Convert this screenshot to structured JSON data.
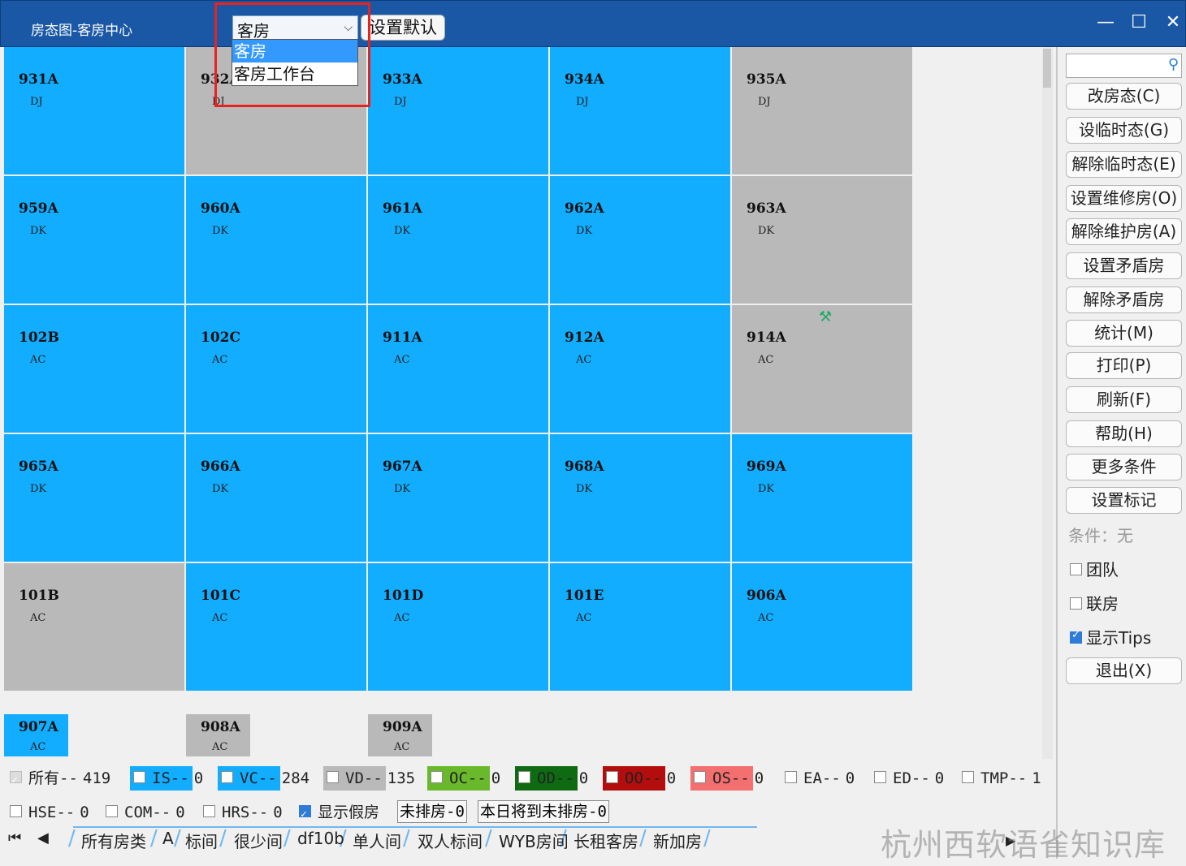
{
  "window": {
    "title": "房态图-客房中心",
    "minimize": "—",
    "maximize": "☐",
    "close": "✕"
  },
  "mode_select": {
    "value": "客房",
    "options": [
      "客房",
      "客房工作台"
    ]
  },
  "set_default_label": "设置默认",
  "rooms": [
    {
      "num": "931A",
      "code": "DJ",
      "status": "blue"
    },
    {
      "num": "932A",
      "code": "DJ",
      "status": "gray"
    },
    {
      "num": "933A",
      "code": "DJ",
      "status": "blue"
    },
    {
      "num": "934A",
      "code": "DJ",
      "status": "blue"
    },
    {
      "num": "935A",
      "code": "DJ",
      "status": "gray"
    },
    {
      "num": "959A",
      "code": "DK",
      "status": "blue"
    },
    {
      "num": "960A",
      "code": "DK",
      "status": "blue"
    },
    {
      "num": "961A",
      "code": "DK",
      "status": "blue"
    },
    {
      "num": "962A",
      "code": "DK",
      "status": "blue"
    },
    {
      "num": "963A",
      "code": "DK",
      "status": "gray"
    },
    {
      "num": "102B",
      "code": "AC",
      "status": "blue"
    },
    {
      "num": "102C",
      "code": "AC",
      "status": "blue"
    },
    {
      "num": "911A",
      "code": "AC",
      "status": "blue"
    },
    {
      "num": "912A",
      "code": "AC",
      "status": "blue"
    },
    {
      "num": "914A",
      "code": "AC",
      "status": "gray"
    },
    {
      "num": "965A",
      "code": "DK",
      "status": "blue"
    },
    {
      "num": "966A",
      "code": "DK",
      "status": "blue"
    },
    {
      "num": "967A",
      "code": "DK",
      "status": "blue"
    },
    {
      "num": "968A",
      "code": "DK",
      "status": "blue"
    },
    {
      "num": "969A",
      "code": "DK",
      "status": "blue"
    },
    {
      "num": "101B",
      "code": "AC",
      "status": "gray"
    },
    {
      "num": "101C",
      "code": "AC",
      "status": "blue"
    },
    {
      "num": "101D",
      "code": "AC",
      "status": "blue"
    },
    {
      "num": "101E",
      "code": "AC",
      "status": "blue"
    },
    {
      "num": "906A",
      "code": "AC",
      "status": "blue"
    }
  ],
  "small_rooms": [
    {
      "num": "907A",
      "code": "AC",
      "status": "blue"
    },
    {
      "num": "908A",
      "code": "AC",
      "status": "gray"
    },
    {
      "num": "909A",
      "code": "AC",
      "status": "gray"
    }
  ],
  "maintenance_icon": "tools-icon",
  "side": {
    "search_placeholder": "",
    "buttons": [
      "改房态(C)",
      "设临时态(G)",
      "解除临时态(E)",
      "设置维修房(O)",
      "解除维护房(A)",
      "设置矛盾房",
      "解除矛盾房",
      "统计(M)",
      "打印(P)",
      "刷新(F)",
      "帮助(H)",
      "更多条件",
      "设置标记"
    ],
    "condition_label": "条件：无",
    "checks": [
      {
        "label": "团队",
        "checked": false
      },
      {
        "label": "联房",
        "checked": false
      },
      {
        "label": "显示Tips",
        "checked": true
      }
    ],
    "exit_label": "退出(X)"
  },
  "legend": {
    "row1": [
      {
        "label": "所有--",
        "count": "419",
        "color": "transparent",
        "checked": true
      },
      {
        "label": "IS--",
        "count": "0",
        "color": "#12adff",
        "checked": false
      },
      {
        "label": "VC--",
        "count": "284",
        "color": "#12adff",
        "checked": false
      },
      {
        "label": "VD--",
        "count": "135",
        "color": "#b9b9b9",
        "checked": false
      },
      {
        "label": "OC--",
        "count": "0",
        "color": "#6ab92c",
        "checked": false
      },
      {
        "label": "OD--",
        "count": "0",
        "color": "#0e6b12",
        "checked": false
      },
      {
        "label": "OO--",
        "count": "0",
        "color": "#b30d0d",
        "checked": false
      },
      {
        "label": "OS--",
        "count": "0",
        "color": "#f46f6f",
        "checked": false
      },
      {
        "label": "EA--",
        "count": "0",
        "color": "transparent",
        "checked": false
      },
      {
        "label": "ED--",
        "count": "0",
        "color": "transparent",
        "checked": false
      },
      {
        "label": "TMP--",
        "count": "1",
        "color": "transparent",
        "checked": false
      }
    ],
    "row2": [
      {
        "label": "HSE--",
        "count": "0",
        "checked": false
      },
      {
        "label": "COM--",
        "count": "0",
        "checked": false
      },
      {
        "label": "HRS--",
        "count": "0",
        "checked": false
      }
    ],
    "show_fake": "显示假房",
    "unassigned": "未排房-0",
    "today_unassigned": "本日将到未排房-0"
  },
  "tabs": [
    "所有房类",
    "A",
    "标间",
    "很少间",
    "df10b",
    "单人间",
    "双人标间",
    "WYB房间",
    "长租客房",
    "新加房"
  ],
  "watermark": "杭州西软语雀知识库"
}
